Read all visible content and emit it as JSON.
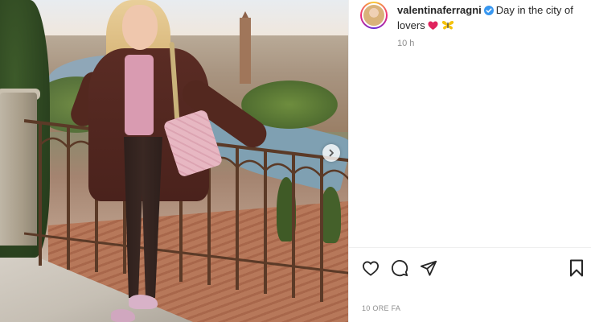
{
  "post": {
    "username": "valentinaferragni",
    "caption": "Day in the city of lovers",
    "caption_emojis": "❤️🦋",
    "time_ago": "10 h",
    "timestamp": "10 ORE FA"
  },
  "icons": {
    "verified": "verified-badge-icon",
    "like": "heart-icon",
    "comment": "comment-icon",
    "share": "share-icon",
    "save": "bookmark-icon",
    "next": "chevron-right-icon"
  },
  "colors": {
    "verified": "#3897f0",
    "heart": "#ed4956",
    "text": "#262626",
    "muted": "#8e8e8e"
  }
}
